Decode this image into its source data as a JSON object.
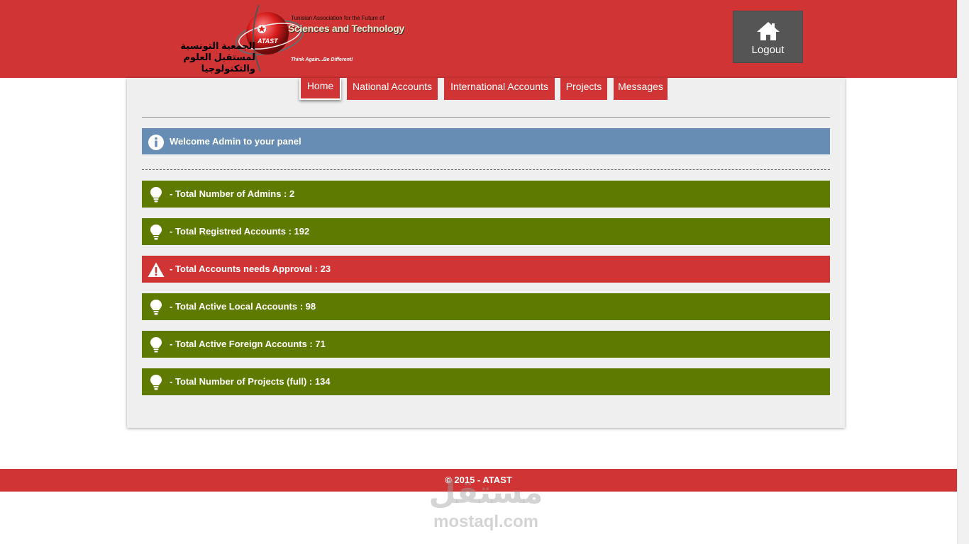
{
  "logo": {
    "english_line1": "Tunisian Association for the Future of",
    "english_line2": "Sciences and Technology",
    "arabic": "الجمعية التونسية لمستقبل العلوم والتكنولوجيا",
    "badge": "ATAST",
    "tagline": "Think Again...Be Different!"
  },
  "header": {
    "logout_label": "Logout",
    "logout_icon": "home-icon"
  },
  "nav": [
    {
      "label": "Home",
      "active": true
    },
    {
      "label": "National Accounts"
    },
    {
      "label": "International Accounts"
    },
    {
      "label": "Projects"
    },
    {
      "label": "Messages"
    }
  ],
  "welcome": {
    "text": "Welcome Admin to your panel",
    "icon": "info-icon"
  },
  "stats": [
    {
      "text": "- Total Number of Admins : 2",
      "icon": "bulb-icon",
      "status": "ok"
    },
    {
      "text": "- Total Registred Accounts : 192",
      "icon": "bulb-icon",
      "status": "ok"
    },
    {
      "text": "- Total Accounts needs Approval : 23",
      "icon": "warning-icon",
      "status": "warn"
    },
    {
      "text": "- Total Active Local Accounts : 98",
      "icon": "bulb-icon",
      "status": "ok"
    },
    {
      "text": "- Total Active Foreign Accounts : 71",
      "icon": "bulb-icon",
      "status": "ok"
    },
    {
      "text": "- Total Number of Projects (full) : 134",
      "icon": "bulb-icon",
      "status": "ok"
    }
  ],
  "footer": {
    "text": "© 2015 - ATAST"
  },
  "watermark": {
    "arabic": "مستقل",
    "latin": "mostaql.com"
  },
  "colors": {
    "brand_red": "#d03434",
    "ok_green": "#5f7a00",
    "info_blue": "#688db5",
    "logout_gray": "#555555",
    "panel_bg": "#efefef"
  }
}
